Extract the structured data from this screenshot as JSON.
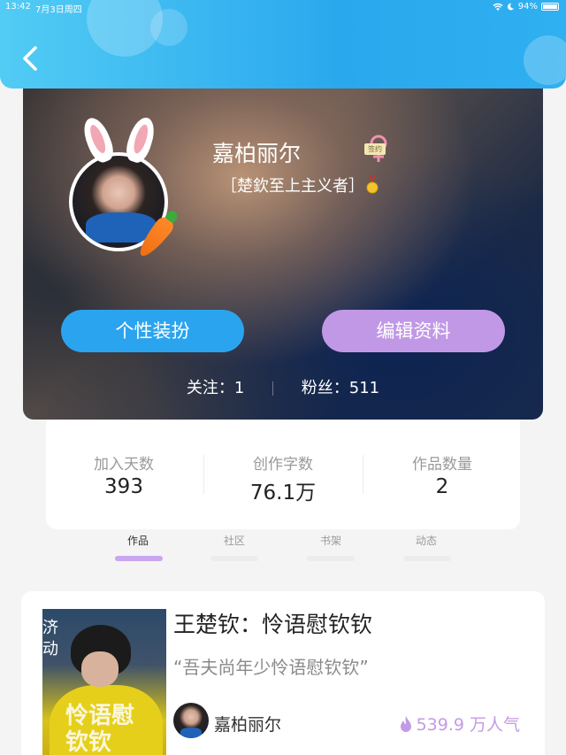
{
  "status_bar": {
    "time": "13:42",
    "date": "7月3日周四",
    "battery": "94%"
  },
  "profile": {
    "name": "嘉柏丽尔",
    "gender_icon": "female-icon",
    "sign_badge": "签约",
    "motto": "［楚欽至上主义者］",
    "buttons": {
      "dress_up": "个性装扮",
      "edit_profile": "编辑资料"
    },
    "following_label": "关注：",
    "following": "1",
    "fans_label": "粉丝：",
    "fans": "511"
  },
  "stats": [
    {
      "label": "加入天数",
      "value": "393"
    },
    {
      "label": "创作字数",
      "value": "76.1万"
    },
    {
      "label": "作品数量",
      "value": "2"
    }
  ],
  "tabs": [
    {
      "label": "作品",
      "active": true
    },
    {
      "label": "社区",
      "active": false
    },
    {
      "label": "书架",
      "active": false
    },
    {
      "label": "动态",
      "active": false
    }
  ],
  "work": {
    "title": "王楚钦：怜语慰钦钦",
    "quote": "“吾夫尚年少怜语慰钦钦”",
    "author": "嘉柏丽尔",
    "popularity": "539.9 万人气",
    "cover_title": "怜语慰钦钦",
    "cover_side_text": "济动"
  },
  "colors": {
    "header": "#2aa8ee",
    "dress_button": "#2ba4f0",
    "edit_button": "#c198e6",
    "tab_active_indicator": "#c9a6ef",
    "popularity": "#c29be7"
  }
}
